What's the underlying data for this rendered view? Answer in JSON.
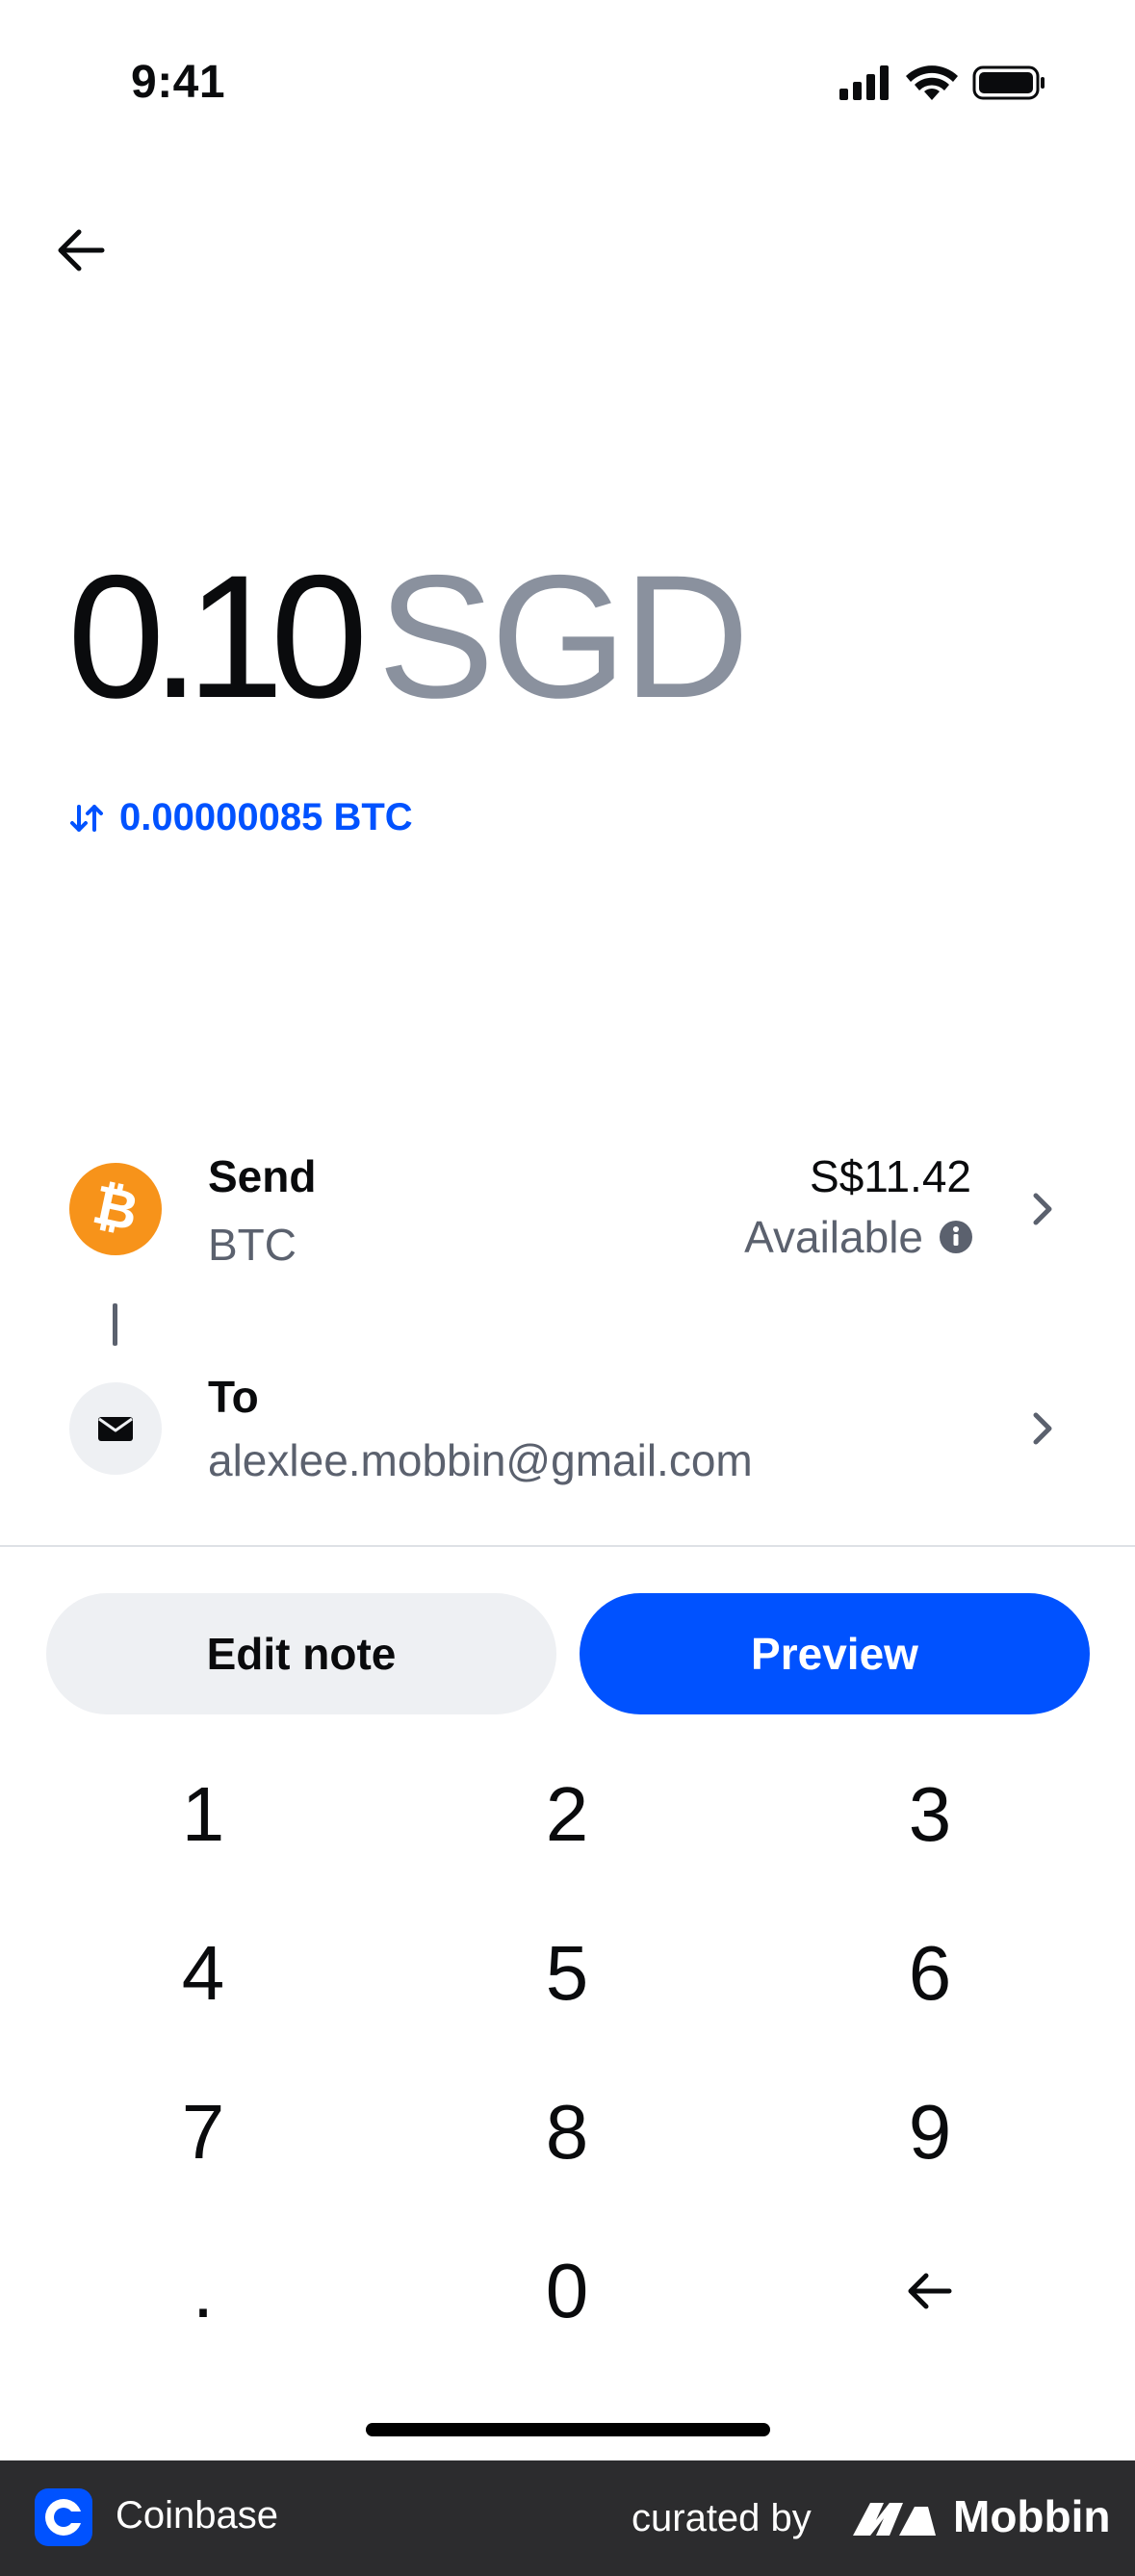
{
  "status_bar": {
    "time": "9:41"
  },
  "amount": {
    "value": "0.10",
    "currency": "SGD"
  },
  "crypto_equivalent": "0.00000085 BTC",
  "send": {
    "label": "Send",
    "asset": "BTC",
    "balance": "S$11.42",
    "available_label": "Available"
  },
  "to": {
    "label": "To",
    "recipient": "alexlee.mobbin@gmail.com"
  },
  "buttons": {
    "edit_note": "Edit note",
    "preview": "Preview"
  },
  "keypad": {
    "keys": [
      "1",
      "2",
      "3",
      "4",
      "5",
      "6",
      "7",
      "8",
      "9",
      ".",
      "0"
    ]
  },
  "footer": {
    "app_name": "Coinbase",
    "curated_by": "curated by",
    "brand": "Mobbin"
  },
  "colors": {
    "accent": "#0052ff",
    "bitcoin": "#f7931a",
    "muted": "#8a919e"
  }
}
